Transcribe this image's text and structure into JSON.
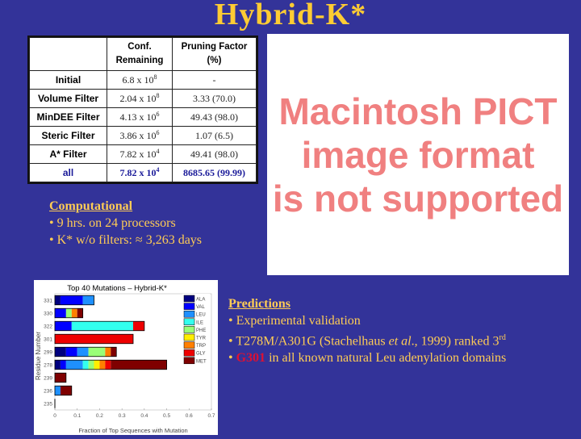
{
  "slide": {
    "title": "Hybrid-K*"
  },
  "table": {
    "headers": [
      "",
      "Conf.\nRemaining",
      "Pruning Factor\n(%)"
    ],
    "rows": [
      {
        "label": "Initial",
        "conf_base": "6.8 x 10",
        "conf_exp": "8",
        "pruning": "-"
      },
      {
        "label": "Volume Filter",
        "conf_base": "2.04 x 10",
        "conf_exp": "8",
        "pruning": "3.33 (70.0)"
      },
      {
        "label": "MinDEE Filter",
        "conf_base": "4.13 x 10",
        "conf_exp": "6",
        "pruning": "49.43 (98.0)"
      },
      {
        "label": "Steric Filter",
        "conf_base": "3.86 x 10",
        "conf_exp": "6",
        "pruning": "1.07 (6.5)"
      },
      {
        "label": "A* Filter",
        "conf_base": "7.82 x 10",
        "conf_exp": "4",
        "pruning": "49.41 (98.0)"
      },
      {
        "label": "all",
        "conf_base": "7.82 x 10",
        "conf_exp": "4",
        "pruning": "8685.65 (99.99)"
      }
    ]
  },
  "placeholder": {
    "text": "Macintosh PICT\nimage format\nis not supported"
  },
  "computational": {
    "heading": "Computational",
    "bullets": [
      "• 9 hrs. on 24 processors",
      "• K* w/o filters: ≈ 3,263  days"
    ]
  },
  "predictions": {
    "heading": "Predictions",
    "bullet1": "• Experimental validation",
    "bullet2_pre": "• T278M/A301G (Stachelhaus ",
    "bullet2_ital": "et al",
    "bullet2_post": "., 1999) ranked 3",
    "bullet2_sup": "rd",
    "bullet3_bullet": "• ",
    "bullet3_hl": "G301",
    "bullet3_post": " in all known natural Leu adenylation domains"
  },
  "chart_data": {
    "type": "bar",
    "orientation": "horizontal-stacked",
    "title": "Top 40 Mutations – Hybrid-K*",
    "xlabel": "Fraction of Top Sequences with Mutation",
    "ylabel": "Residue Number",
    "xlim": [
      0,
      0.7
    ],
    "xticks": [
      "0",
      "0.1",
      "0.2",
      "0.3",
      "0.4",
      "0.5",
      "0.6",
      "0.7"
    ],
    "categories": [
      "331",
      "330",
      "322",
      "301",
      "299",
      "278",
      "239",
      "236",
      "235"
    ],
    "legend_position": "top-right",
    "series": [
      {
        "name": "ALA",
        "color": "#00007f",
        "values": [
          0.025,
          0,
          0,
          0,
          0.05,
          0.025,
          0,
          0,
          0
        ]
      },
      {
        "name": "VAL",
        "color": "#0000ff",
        "values": [
          0.1,
          0.05,
          0.075,
          0,
          0.05,
          0.025,
          0,
          0,
          0
        ]
      },
      {
        "name": "LEU",
        "color": "#1e90ff",
        "values": [
          0.05,
          0,
          0,
          0,
          0.05,
          0.075,
          0,
          0.025,
          0
        ]
      },
      {
        "name": "ILE",
        "color": "#33ffee",
        "values": [
          0,
          0,
          0.275,
          0,
          0,
          0.025,
          0,
          0,
          0
        ]
      },
      {
        "name": "PHE",
        "color": "#99ff77",
        "values": [
          0,
          0.025,
          0,
          0,
          0.075,
          0.025,
          0,
          0,
          0
        ]
      },
      {
        "name": "TYR",
        "color": "#ffee00",
        "values": [
          0,
          0,
          0,
          0,
          0,
          0.025,
          0,
          0,
          0
        ]
      },
      {
        "name": "TRP",
        "color": "#ff7f00",
        "values": [
          0,
          0.025,
          0,
          0,
          0.025,
          0.025,
          0,
          0,
          0
        ]
      },
      {
        "name": "GLY",
        "color": "#ee0000",
        "values": [
          0,
          0,
          0.05,
          0.35,
          0,
          0.025,
          0,
          0,
          0
        ]
      },
      {
        "name": "MET",
        "color": "#7f0000",
        "values": [
          0,
          0.025,
          0,
          0,
          0.025,
          0.25,
          0.05,
          0.05,
          0
        ]
      }
    ]
  }
}
